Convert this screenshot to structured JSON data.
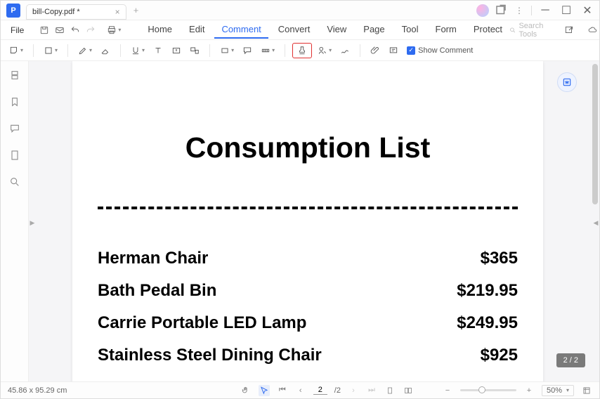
{
  "app": {
    "tab_title": "bill-Copy.pdf *"
  },
  "menubar": {
    "file": "File",
    "tabs": [
      "Home",
      "Edit",
      "Comment",
      "Convert",
      "View",
      "Page",
      "Tool",
      "Form",
      "Protect"
    ],
    "active": "Comment",
    "search_placeholder": "Search Tools"
  },
  "toolbar": {
    "show_comment": "Show Comment"
  },
  "document": {
    "title": "Consumption List",
    "items": [
      {
        "name": "Herman Chair",
        "price": "$365"
      },
      {
        "name": "Bath Pedal Bin",
        "price": "$219.95"
      },
      {
        "name": "Carrie Portable LED Lamp",
        "price": "$249.95"
      },
      {
        "name": "Stainless Steel Dining Chair",
        "price": "$925"
      }
    ]
  },
  "status": {
    "dimensions": "45.86 x 95.29 cm",
    "current_page": "2",
    "total_pages": "/2",
    "page_badge": "2 / 2",
    "zoom": "50%"
  }
}
